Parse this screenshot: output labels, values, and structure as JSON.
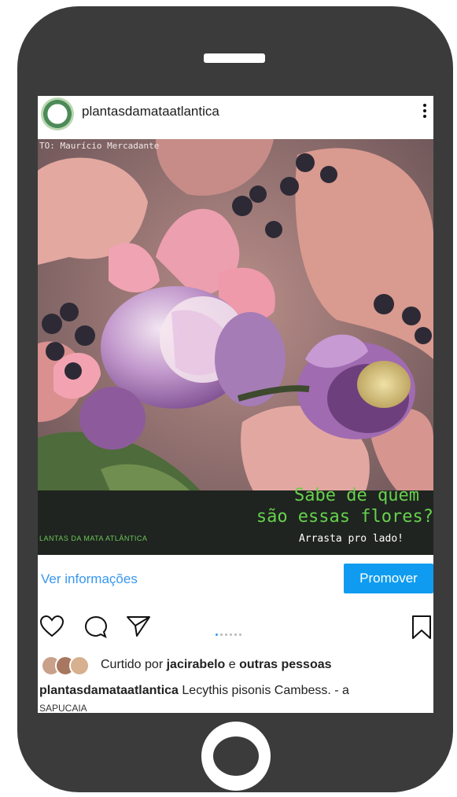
{
  "post": {
    "username": "plantasdamataatlantica",
    "photo": {
      "credit": "TO: Maurício Mercadante",
      "title_line1": "Sabe de quem",
      "title_line2": "são essas flores?",
      "swipe_text": "Arrasta pro lado!",
      "brand_text": "LANTAS DA MATA ATLÂNTICA"
    },
    "info_link": "Ver informações",
    "promote_label": "Promover",
    "carousel": {
      "count": 6,
      "active_index": 0
    },
    "likes": {
      "prefix": "Curtido por",
      "user": "jacirabelo",
      "connector": "e",
      "others": "outras pessoas"
    },
    "caption": {
      "user": "plantasdamataatlantica",
      "text": "Lecythis pisonis Cambess. - a",
      "cut_text": "SAPUCAIA"
    }
  },
  "colors": {
    "phone_body": "#3b3b3b",
    "link_blue": "#3897f0",
    "promote_button": "#0f9cf0",
    "title_green": "#66d14d"
  },
  "icons": [
    "more-options-icon",
    "heart-icon",
    "comment-icon",
    "share-icon",
    "bookmark-icon",
    "home-button"
  ]
}
